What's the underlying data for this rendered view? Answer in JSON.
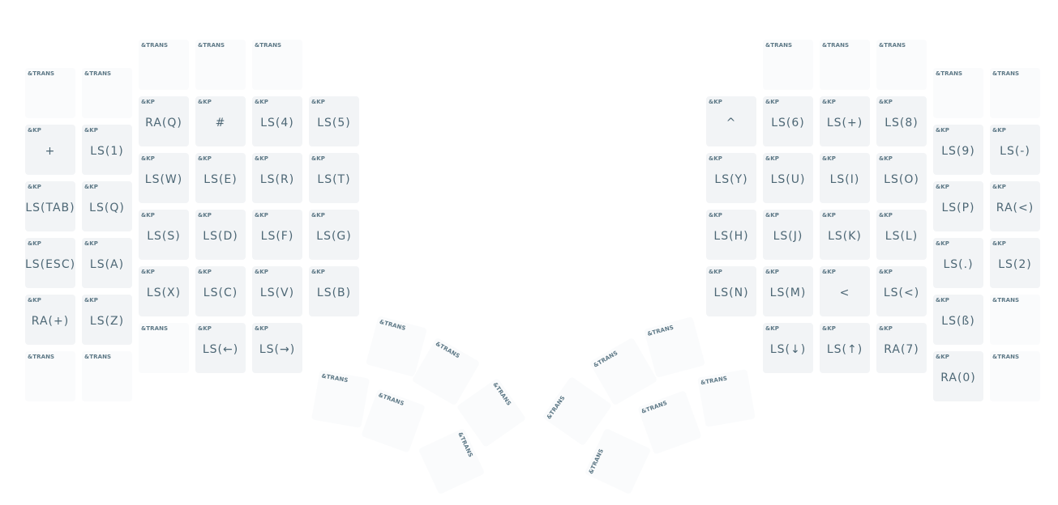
{
  "keymap": {
    "left": [
      {
        "tag": "&TRANS",
        "label": ""
      },
      {
        "tag": "&TRANS",
        "label": ""
      },
      {
        "tag": "&TRANS",
        "label": ""
      },
      {
        "tag": "&TRANS",
        "label": ""
      },
      {
        "tag": "&TRANS",
        "label": ""
      },
      {
        "tag": "&KP",
        "label": "RA(Q)"
      },
      {
        "tag": "&KP",
        "label": "#"
      },
      {
        "tag": "&KP",
        "label": "LS(4)"
      },
      {
        "tag": "&KP",
        "label": "LS(5)"
      },
      {
        "tag": "&KP",
        "label": "+"
      },
      {
        "tag": "&KP",
        "label": "LS(1)"
      },
      {
        "tag": "&KP",
        "label": "LS(W)"
      },
      {
        "tag": "&KP",
        "label": "LS(E)"
      },
      {
        "tag": "&KP",
        "label": "LS(R)"
      },
      {
        "tag": "&KP",
        "label": "LS(T)"
      },
      {
        "tag": "&KP",
        "label": "LS(TAB)"
      },
      {
        "tag": "&KP",
        "label": "LS(Q)"
      },
      {
        "tag": "&KP",
        "label": "LS(S)"
      },
      {
        "tag": "&KP",
        "label": "LS(D)"
      },
      {
        "tag": "&KP",
        "label": "LS(F)"
      },
      {
        "tag": "&KP",
        "label": "LS(G)"
      },
      {
        "tag": "&KP",
        "label": "LS(ESC)"
      },
      {
        "tag": "&KP",
        "label": "LS(A)"
      },
      {
        "tag": "&KP",
        "label": "LS(X)"
      },
      {
        "tag": "&KP",
        "label": "LS(C)"
      },
      {
        "tag": "&KP",
        "label": "LS(V)"
      },
      {
        "tag": "&KP",
        "label": "LS(B)"
      },
      {
        "tag": "&KP",
        "label": "RA(+)"
      },
      {
        "tag": "&KP",
        "label": "LS(Z)"
      },
      {
        "tag": "&TRANS",
        "label": ""
      },
      {
        "tag": "&KP",
        "label": "LS(←)"
      },
      {
        "tag": "&KP",
        "label": "LS(→)"
      },
      {
        "tag": "&TRANS",
        "label": ""
      },
      {
        "tag": "&TRANS",
        "label": ""
      }
    ],
    "left_thumb": [
      {
        "tag": "&TRANS",
        "label": ""
      },
      {
        "tag": "&TRANS",
        "label": ""
      },
      {
        "tag": "&TRANS",
        "label": ""
      },
      {
        "tag": "&TRANS",
        "label": ""
      },
      {
        "tag": "&TRANS",
        "label": ""
      },
      {
        "tag": "&TRANS",
        "label": ""
      }
    ],
    "right": [
      {
        "tag": "&TRANS",
        "label": ""
      },
      {
        "tag": "&TRANS",
        "label": ""
      },
      {
        "tag": "&TRANS",
        "label": ""
      },
      {
        "tag": "&TRANS",
        "label": ""
      },
      {
        "tag": "&TRANS",
        "label": ""
      },
      {
        "tag": "&KP",
        "label": "^"
      },
      {
        "tag": "&KP",
        "label": "LS(6)"
      },
      {
        "tag": "&KP",
        "label": "LS(+)"
      },
      {
        "tag": "&KP",
        "label": "LS(8)"
      },
      {
        "tag": "&KP",
        "label": "LS(9)"
      },
      {
        "tag": "&KP",
        "label": "LS(-)"
      },
      {
        "tag": "&KP",
        "label": "LS(Y)"
      },
      {
        "tag": "&KP",
        "label": "LS(U)"
      },
      {
        "tag": "&KP",
        "label": "LS(I)"
      },
      {
        "tag": "&KP",
        "label": "LS(O)"
      },
      {
        "tag": "&KP",
        "label": "LS(P)"
      },
      {
        "tag": "&KP",
        "label": "RA(<)"
      },
      {
        "tag": "&KP",
        "label": "LS(H)"
      },
      {
        "tag": "&KP",
        "label": "LS(J)"
      },
      {
        "tag": "&KP",
        "label": "LS(K)"
      },
      {
        "tag": "&KP",
        "label": "LS(L)"
      },
      {
        "tag": "&KP",
        "label": "LS(.)"
      },
      {
        "tag": "&KP",
        "label": "LS(2)"
      },
      {
        "tag": "&KP",
        "label": "LS(N)"
      },
      {
        "tag": "&KP",
        "label": "LS(M)"
      },
      {
        "tag": "&KP",
        "label": "<"
      },
      {
        "tag": "&KP",
        "label": "LS(<)"
      },
      {
        "tag": "&KP",
        "label": "LS(ß)"
      },
      {
        "tag": "&TRANS",
        "label": ""
      },
      {
        "tag": "&KP",
        "label": "LS(↓)"
      },
      {
        "tag": "&KP",
        "label": "LS(↑)"
      },
      {
        "tag": "&KP",
        "label": "RA(7)"
      },
      {
        "tag": "&KP",
        "label": "RA(0)"
      },
      {
        "tag": "&TRANS",
        "label": ""
      }
    ],
    "right_thumb": [
      {
        "tag": "&TRANS",
        "label": ""
      },
      {
        "tag": "&TRANS",
        "label": ""
      },
      {
        "tag": "&TRANS",
        "label": ""
      },
      {
        "tag": "&TRANS",
        "label": ""
      },
      {
        "tag": "&TRANS",
        "label": ""
      },
      {
        "tag": "&TRANS",
        "label": ""
      }
    ]
  },
  "colors": {
    "key_bg": "#f2f4f6",
    "trans_bg": "#fafbfc",
    "tag_text": "#5d7886",
    "label_text": "#4d6775"
  }
}
